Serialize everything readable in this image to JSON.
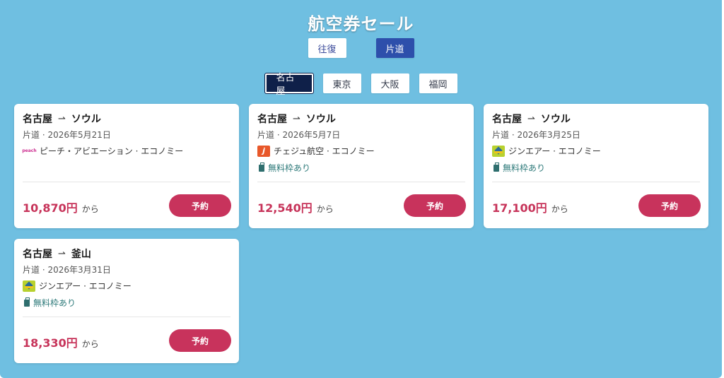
{
  "page_title": "航空券セール",
  "trip_types": [
    {
      "label": "往復",
      "active": false
    },
    {
      "label": "片道",
      "active": true
    }
  ],
  "cities": [
    {
      "label": "名古屋",
      "active": true
    },
    {
      "label": "東京",
      "active": false
    },
    {
      "label": "大阪",
      "active": false
    },
    {
      "label": "福岡",
      "active": false
    }
  ],
  "cards": [
    {
      "origin": "名古屋",
      "arrow": "⇀",
      "destination": "ソウル",
      "date": "片道 · 2026年5月21日",
      "airline_logo": "peach-logo",
      "logo_text": "peach",
      "airline": "ピーチ・アビエーション · エコノミー",
      "baggage": "",
      "price": "10,870円",
      "from": "から",
      "book_label": "予約"
    },
    {
      "origin": "名古屋",
      "arrow": "⇀",
      "destination": "ソウル",
      "date": "片道 · 2026年5月7日",
      "airline_logo": "jeju-air-logo",
      "logo_text": "j",
      "airline": "チェジュ航空 · エコノミー",
      "baggage": "無料枠あり",
      "price": "12,540円",
      "from": "から",
      "book_label": "予約"
    },
    {
      "origin": "名古屋",
      "arrow": "⇀",
      "destination": "ソウル",
      "date": "片道 · 2026年3月25日",
      "airline_logo": "jin-air-logo",
      "logo_text": "",
      "airline": "ジンエアー · エコノミー",
      "baggage": "無料枠あり",
      "price": "17,100円",
      "from": "から",
      "book_label": "予約"
    },
    {
      "origin": "名古屋",
      "arrow": "⇀",
      "destination": "釜山",
      "date": "片道 · 2026年3月31日",
      "airline_logo": "jin-air-logo",
      "logo_text": "",
      "airline": "ジンエアー · エコノミー",
      "baggage": "無料枠あり",
      "price": "18,330円",
      "from": "から",
      "book_label": "予約"
    }
  ],
  "colors": {
    "background": "#6fbfe1",
    "price": "#c7345a",
    "book_button": "#c8335c",
    "active_trip": "#2d4fab",
    "active_city": "#0f2049"
  }
}
